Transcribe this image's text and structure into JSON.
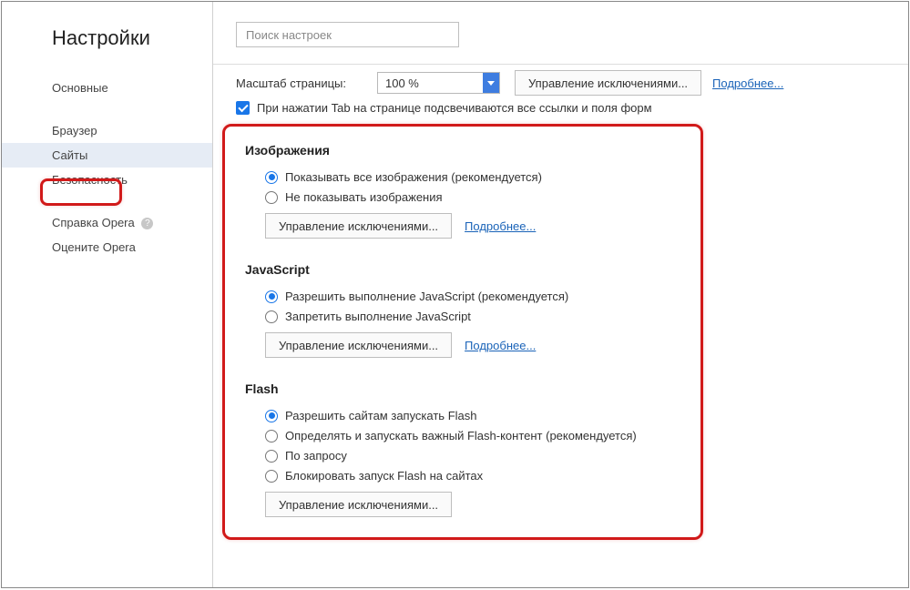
{
  "title": "Настройки",
  "nav": {
    "block1": [
      "Основные"
    ],
    "block2": [
      "Браузер",
      "Сайты",
      "Безопасность"
    ],
    "block3": {
      "help": "Справка Opera",
      "rate": "Оцените Opera"
    },
    "selected": "Сайты"
  },
  "search": {
    "placeholder": "Поиск настроек"
  },
  "scale": {
    "label": "Масштаб страницы:",
    "value": "100 %",
    "exceptions": "Управление исключениями...",
    "more": "Подробнее..."
  },
  "tab_focus": {
    "checked": true,
    "label": "При нажатии Tab на странице подсвечиваются все ссылки и поля форм"
  },
  "sections": {
    "images": {
      "title": "Изображения",
      "options": [
        {
          "label": "Показывать все изображения (рекомендуется)",
          "checked": true
        },
        {
          "label": "Не показывать изображения",
          "checked": false
        }
      ],
      "exceptions": "Управление исключениями...",
      "more": "Подробнее..."
    },
    "javascript": {
      "title": "JavaScript",
      "options": [
        {
          "label": "Разрешить выполнение JavaScript (рекомендуется)",
          "checked": true
        },
        {
          "label": "Запретить выполнение JavaScript",
          "checked": false
        }
      ],
      "exceptions": "Управление исключениями...",
      "more": "Подробнее..."
    },
    "flash": {
      "title": "Flash",
      "options": [
        {
          "label": "Разрешить сайтам запускать Flash",
          "checked": true
        },
        {
          "label": "Определять и запускать важный Flash-контент (рекомендуется)",
          "checked": false
        },
        {
          "label": "По запросу",
          "checked": false
        },
        {
          "label": "Блокировать запуск Flash на сайтах",
          "checked": false
        }
      ],
      "exceptions": "Управление исключениями..."
    }
  }
}
